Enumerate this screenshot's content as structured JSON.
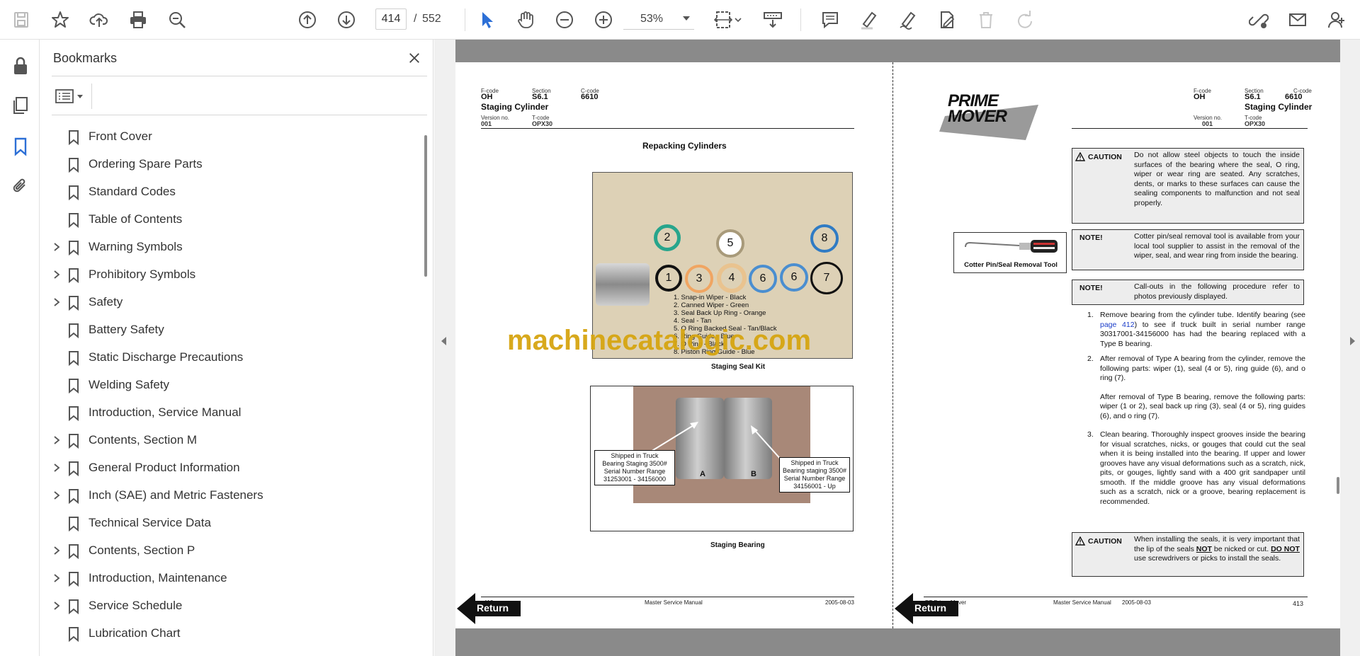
{
  "toolbar": {
    "current_page": "414",
    "page_separator": "/",
    "total_pages": "552",
    "zoom": "53%"
  },
  "bookmarks": {
    "title": "Bookmarks",
    "items": [
      {
        "label": "Front Cover",
        "expandable": false
      },
      {
        "label": "Ordering Spare Parts",
        "expandable": false
      },
      {
        "label": "Standard Codes",
        "expandable": false
      },
      {
        "label": "Table of Contents",
        "expandable": false
      },
      {
        "label": "Warning Symbols",
        "expandable": true
      },
      {
        "label": "Prohibitory Symbols",
        "expandable": true
      },
      {
        "label": "Safety",
        "expandable": true
      },
      {
        "label": "Battery Safety",
        "expandable": false
      },
      {
        "label": "Static Discharge Precautions",
        "expandable": false
      },
      {
        "label": "Welding Safety",
        "expandable": false
      },
      {
        "label": "Introduction, Service Manual",
        "expandable": false
      },
      {
        "label": "Contents, Section M",
        "expandable": true
      },
      {
        "label": "General Product Information",
        "expandable": true
      },
      {
        "label": "Inch (SAE) and Metric Fasteners",
        "expandable": true
      },
      {
        "label": "Technical Service Data",
        "expandable": false
      },
      {
        "label": "Contents, Section P",
        "expandable": true
      },
      {
        "label": "Introduction, Maintenance",
        "expandable": true
      },
      {
        "label": "Service Schedule",
        "expandable": true
      },
      {
        "label": "Lubrication Chart",
        "expandable": false
      }
    ]
  },
  "doc": {
    "header": {
      "fcode_label": "F-code",
      "fcode": "OH",
      "section_label": "Section",
      "section": "S6.1",
      "ccode_label": "C-code",
      "ccode": "6610",
      "title": "Staging Cylinder",
      "version_label": "Version no.",
      "version": "001",
      "tcode_label": "T-code",
      "tcode": "OPX30"
    },
    "left": {
      "section_title": "Repacking Cylinders",
      "rings": [
        "2",
        "5",
        "8",
        "1",
        "3",
        "4",
        "6",
        "6",
        "7"
      ],
      "legend": [
        "1. Snap-in Wiper - Black",
        "2. Canned Wiper - Green",
        "3. Seal Back Up Ring - Orange",
        "4. Seal  - Tan",
        "5. O Ring Backed Seal - Tan/Black",
        "6. Ring Guide - Blue",
        "7. O Ring - Black",
        "8. Piston Ring Guide - Blue"
      ],
      "watermark": "machinecatalogic.com",
      "caption1": "Staging Seal Kit",
      "bearing_a": "A",
      "bearing_b": "B",
      "callout_a": [
        "Shipped in Truck",
        "Bearing Staging 3500#",
        "Serial Number Range",
        "31253001 - 34156000"
      ],
      "callout_b": [
        "Shipped in Truck",
        "Bearing staging 3500#",
        "Serial Number Range",
        "34156001 - Up"
      ],
      "caption2": "Staging Bearing",
      "footer_page": "412",
      "footer_title": "Master Service Manual",
      "footer_date": "2005-08-03",
      "return_label": "Return"
    },
    "right": {
      "logo_line1": "PRIME",
      "logo_line2": "MOVER",
      "caution1_label": "CAUTION",
      "caution1_text": "Do not allow steel objects to touch the inside surfaces of the bearing where the seal, O ring, wiper or wear ring are seated. Any scratches, dents, or marks to these surfaces can cause the sealing components to malfunction and not seal properly.",
      "tool_caption": "Cotter Pin/Seal Removal Tool",
      "note1_label": "NOTE!",
      "note1_text": "Cotter pin/seal removal tool is available from your local tool supplier to assist in the removal of the wiper, seal, and wear ring from inside the bearing.",
      "note2_label": "NOTE!",
      "note2_text": "Call-outs in the following procedure refer to photos previously displayed.",
      "step1_num": "1.",
      "step1_a": "Remove bearing from the cylinder tube. Identify bearing (see ",
      "step1_link": "page 412",
      "step1_b": ") to see if truck built in serial number range 30317001-34156000 has had the bearing replaced with a Type B bearing.",
      "step2_num": "2.",
      "step2_a": "After removal of Type A bearing from the cylinder, remove the following parts: wiper (1), seal (4 or 5), ring guide (6), and o ring (7).",
      "step2_b": "After removal of Type B bearing, remove the following parts: wiper (1 or 2), seal back up ring (3), seal (4 or 5), ring guides (6), and o ring (7).",
      "step3_num": "3.",
      "step3": "Clean bearing. Thoroughly inspect grooves inside the bearing for visual scratches, nicks, or gouges that could cut the seal when it is being installed into the bearing. If upper and lower grooves have any visual deformations such as a scratch, nick, pits, or gouges, lightly sand with a 400 grit sandpaper until smooth. If the middle groove has any visual deformations such as a scratch, nick or a groove, bearing replacement is recommended.",
      "caution2_label": "CAUTION",
      "caution2_a": "When installing the seals, it is very important that the lip of the seals ",
      "caution2_not1": "NOT",
      "caution2_b": " be nicked or cut. ",
      "caution2_not2": "DO NOT",
      "caution2_c": " use screwdrivers or picks to install the seals.",
      "footer_brand": "BT Prime-Mover",
      "footer_title": "Master Service Manual",
      "footer_date": "2005-08-03",
      "footer_page": "413",
      "return_label": "Return"
    }
  }
}
